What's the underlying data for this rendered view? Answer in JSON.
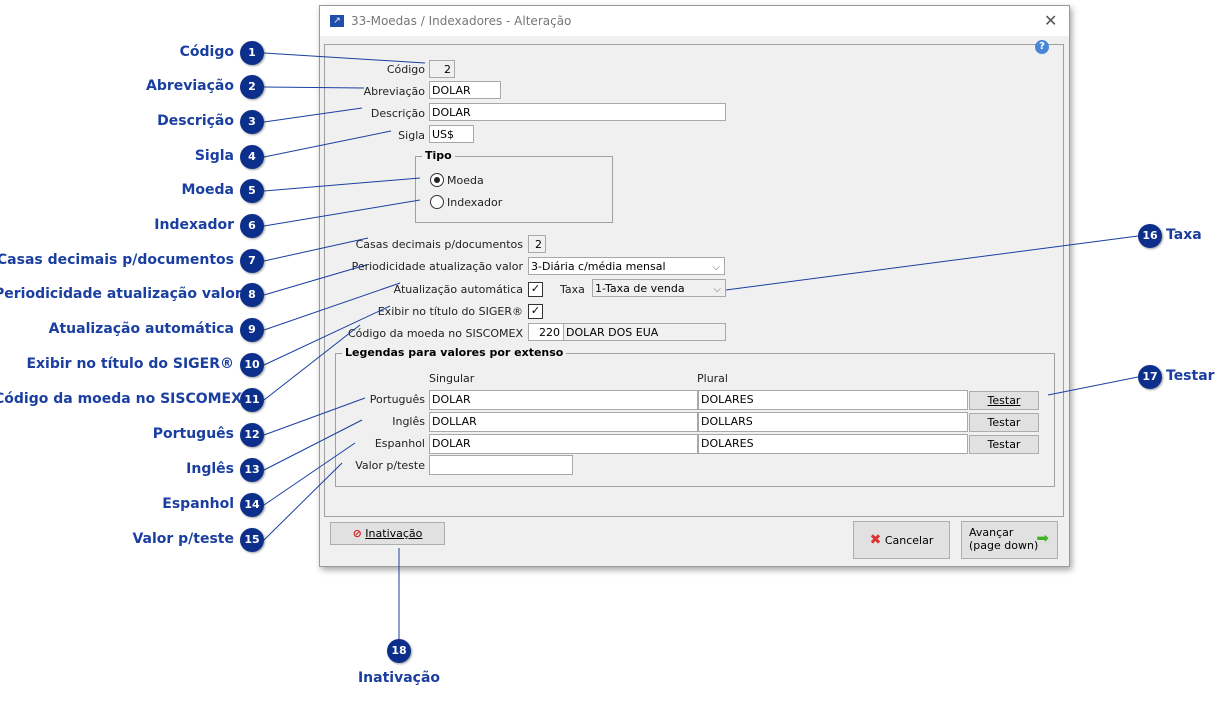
{
  "window": {
    "title": "33-Moedas / Indexadores - Alteração"
  },
  "form": {
    "codigo_label": "Código",
    "codigo": "2",
    "abreviacao_label": "Abreviação",
    "abreviacao": "DOLAR",
    "descricao_label": "Descrição",
    "descricao": "DOLAR",
    "sigla_label": "Sigla",
    "sigla": "US$",
    "tipo_label": "Tipo",
    "tipo_options": [
      "Moeda",
      "Indexador"
    ],
    "tipo_selected": "Moeda",
    "casas_label": "Casas decimais p/documentos",
    "casas": "2",
    "periodicidade_label": "Periodicidade atualização valor",
    "periodicidade": "3-Diária c/média mensal",
    "atualizacao_label": "Atualização automática",
    "atualizacao_checked": true,
    "taxa_label": "Taxa",
    "taxa": "1-Taxa de venda",
    "exibir_label": "Exibir no título do SIGER®",
    "exibir_checked": true,
    "siscomex_label": "Código da moeda no SISCOMEX",
    "siscomex_code": "220",
    "siscomex_desc": "DOLAR DOS EUA",
    "legendas_label": "Legendas para valores por extenso",
    "singular_header": "Singular",
    "plural_header": "Plural",
    "rows": [
      {
        "label": "Português",
        "singular": "DOLAR",
        "plural": "DOLARES",
        "button": "Testar"
      },
      {
        "label": "Inglês",
        "singular": "DOLLAR",
        "plural": "DOLLARS",
        "button": "Testar"
      },
      {
        "label": "Espanhol",
        "singular": "DOLAR",
        "plural": "DOLARES",
        "button": "Testar"
      }
    ],
    "valor_teste_label": "Valor p/teste",
    "valor_teste": ""
  },
  "buttons": {
    "inativacao": "Inativação",
    "cancelar": "Cancelar",
    "avancar_1": "Avançar",
    "avancar_2": "(page down)"
  },
  "callouts": [
    {
      "n": "1",
      "label": "Código"
    },
    {
      "n": "2",
      "label": "Abreviação"
    },
    {
      "n": "3",
      "label": "Descrição"
    },
    {
      "n": "4",
      "label": "Sigla"
    },
    {
      "n": "5",
      "label": "Moeda"
    },
    {
      "n": "6",
      "label": "Indexador"
    },
    {
      "n": "7",
      "label": "Casas decimais p/documentos"
    },
    {
      "n": "8",
      "label": "Periodicidade atualização valor"
    },
    {
      "n": "9",
      "label": "Atualização automática"
    },
    {
      "n": "10",
      "label": "Exibir no título do SIGER®"
    },
    {
      "n": "11",
      "label": "Código da moeda no SISCOMEX"
    },
    {
      "n": "12",
      "label": "Português"
    },
    {
      "n": "13",
      "label": "Inglês"
    },
    {
      "n": "14",
      "label": "Espanhol"
    },
    {
      "n": "15",
      "label": "Valor p/teste"
    },
    {
      "n": "16",
      "label": "Taxa"
    },
    {
      "n": "17",
      "label": "Testar"
    },
    {
      "n": "18",
      "label": "Inativação"
    }
  ],
  "colors": {
    "callout": "#0d2f8c",
    "callout_text": "#1a3fa0"
  }
}
